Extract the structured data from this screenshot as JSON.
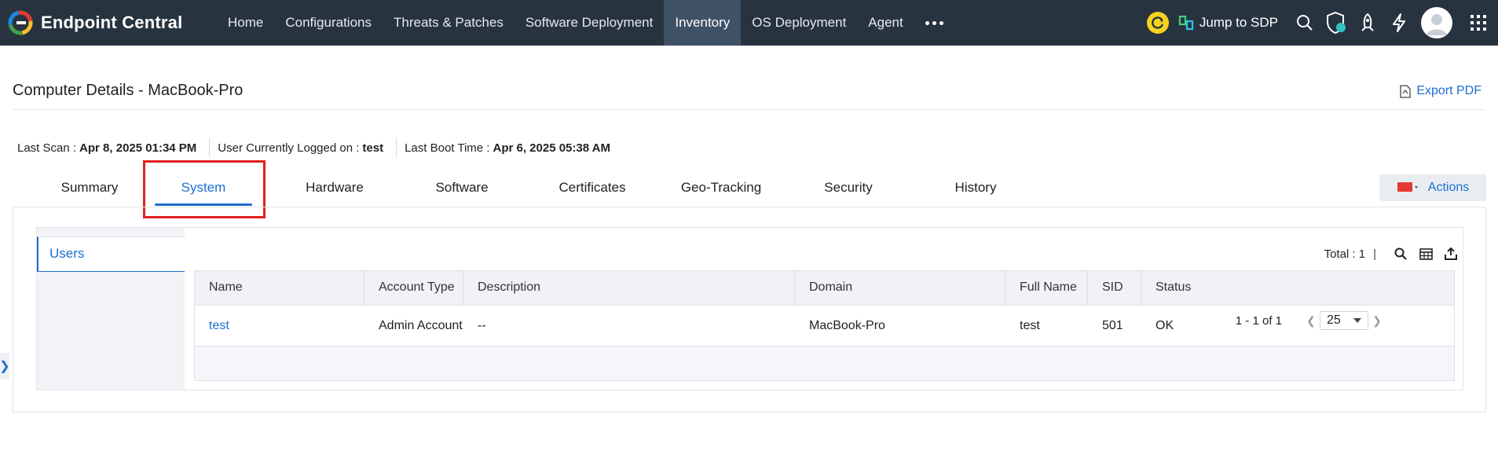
{
  "app": {
    "brand": "Endpoint Central"
  },
  "nav": {
    "items": [
      "Home",
      "Configurations",
      "Threats & Patches",
      "Software Deployment",
      "Inventory",
      "OS Deployment",
      "Agent"
    ],
    "active": "Inventory"
  },
  "topbar_right": {
    "jump_label": "Jump to SDP"
  },
  "page": {
    "title": "Computer Details - MacBook-Pro",
    "export_label": "Export PDF"
  },
  "meta": {
    "last_scan_label": "Last Scan :",
    "last_scan_value": "Apr 8, 2025 01:34 PM",
    "user_label": "User Currently Logged on :",
    "user_value": "test",
    "boot_label": "Last Boot Time :",
    "boot_value": "Apr 6, 2025 05:38 AM"
  },
  "tabs": [
    "Summary",
    "System",
    "Hardware",
    "Software",
    "Certificates",
    "Geo-Tracking",
    "Security",
    "History"
  ],
  "active_tab": "System",
  "actions_label": "Actions",
  "side_menu": {
    "items": [
      "Users"
    ]
  },
  "table": {
    "total_label": "Total : 1",
    "columns": [
      "Name",
      "Account Type",
      "Description",
      "Domain",
      "Full Name",
      "SID",
      "Status"
    ],
    "rows": [
      [
        "test",
        "Admin Account",
        "--",
        "MacBook-Pro",
        "test",
        "501",
        "OK"
      ]
    ],
    "pagination": {
      "range": "1 - 1 of 1",
      "page_size": "25"
    }
  },
  "colors": {
    "topbar": "#283340",
    "accent": "#1e6fcf",
    "highlight": "#e02020"
  }
}
